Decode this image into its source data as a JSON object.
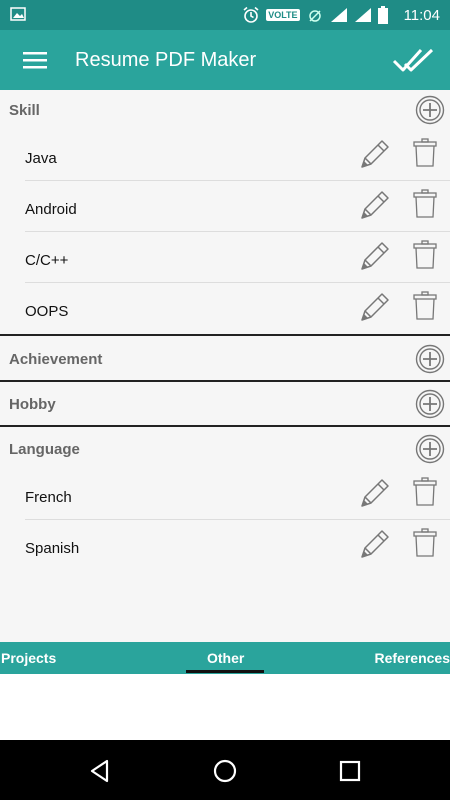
{
  "status_bar": {
    "time": "11:04",
    "network_badge": "VOLTE",
    "icons": [
      "image-icon",
      "alarm-icon",
      "volte-badge",
      "lte-icon",
      "signal-icon",
      "signal-icon",
      "battery-icon"
    ]
  },
  "app_bar": {
    "title": "Resume PDF Maker",
    "menu_icon": "hamburger-menu-icon",
    "action_icon": "double-check-icon"
  },
  "sections": [
    {
      "title": "Skill",
      "items": [
        "Java",
        "Android",
        "C/C++",
        "OOPS"
      ]
    },
    {
      "title": "Achievement",
      "items": []
    },
    {
      "title": "Hobby",
      "items": []
    },
    {
      "title": "Language",
      "items": [
        "French",
        "Spanish"
      ]
    }
  ],
  "tabs": [
    {
      "label": "Projects",
      "active": false
    },
    {
      "label": "Other",
      "active": true
    },
    {
      "label": "References",
      "active": false
    }
  ],
  "colors": {
    "primary": "#2aa49c",
    "primary_dark": "#1f8c86",
    "content_bg": "#f6f6f6",
    "text_dark": "#111111",
    "section_title": "#666666"
  }
}
